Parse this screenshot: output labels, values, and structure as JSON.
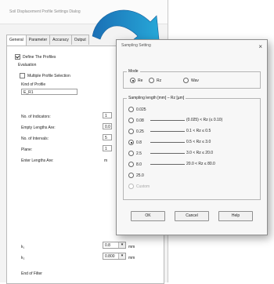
{
  "window": {
    "title": "Soil Displacement Profile Settings Dialog",
    "tabs": [
      "General",
      "Parameter",
      "Accuracy",
      "Output"
    ],
    "define_checkbox": "Define The Profiles",
    "evaluation_label": "Evaluation",
    "multiple_checkbox": "Multiple Profile Selection",
    "kind_label": "Kind of Profile",
    "kind_value": "E_R1",
    "fields": [
      {
        "label": "No. of Indicators:",
        "value": "1"
      },
      {
        "label": "Empty Lengths Are:",
        "value": "0.0"
      },
      {
        "label": "No. of Intervals:",
        "value": "5"
      },
      {
        "label": "Plane:",
        "value": "1"
      },
      {
        "label": "Enter Lengths Are:",
        "value": "m"
      }
    ],
    "bottom_fields": [
      {
        "label": "k₁",
        "value": "0.8",
        "unit": "mm"
      },
      {
        "label": "k₂",
        "value": "0.800",
        "unit": "mm"
      }
    ],
    "end_label": "End of Filter"
  },
  "dialog": {
    "title": "Sampling Setting",
    "close": "×",
    "mode_group": "Mode",
    "mode_options": [
      {
        "label": "Re",
        "selected": true
      },
      {
        "label": "Rz",
        "selected": false
      },
      {
        "label": "Wav",
        "selected": false
      }
    ],
    "sampling_group": "Sampling length [mm] – Rz [µm]",
    "options": [
      {
        "value": "0.025",
        "range": "",
        "selected": false
      },
      {
        "value": "0.08",
        "range": "(0.025) < Rz (≤ 0.10)",
        "selected": false
      },
      {
        "value": "0.25",
        "range": "0.1 < Rz ≤ 0.5",
        "selected": false
      },
      {
        "value": "0.8",
        "range": "0.5 < Rz ≤ 3.0",
        "selected": true
      },
      {
        "value": "2.5",
        "range": "3.0 < Rz ≤ 20.0",
        "selected": false
      },
      {
        "value": "8.0",
        "range": "20.0 < Rz ≤ 80.0",
        "selected": false
      },
      {
        "value": "25.0",
        "range": "",
        "selected": false
      },
      {
        "value": "Custom",
        "range": "",
        "selected": false
      }
    ],
    "buttons": {
      "ok": "OK",
      "cancel": "Cancel",
      "help": "Help"
    }
  },
  "colors": {
    "arrow": "#1a6fb5",
    "arrow_light": "#27a8d8"
  }
}
